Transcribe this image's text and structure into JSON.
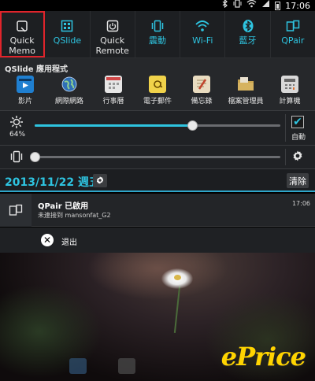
{
  "status_bar": {
    "time": "17:06",
    "icons": [
      "bluetooth-icon",
      "vibrate-icon",
      "wifi-icon",
      "signal-icon",
      "battery-icon"
    ]
  },
  "quick_toggles": [
    {
      "label_line1": "Quick",
      "label_line2": "Memo",
      "icon": "quick-memo-icon",
      "active": false
    },
    {
      "label_line1": "QSlide",
      "label_line2": "",
      "icon": "qslide-icon",
      "active": true
    },
    {
      "label_line1": "Quick",
      "label_line2": "Remote",
      "icon": "quick-remote-icon",
      "active": false
    },
    {
      "label_line1": "震動",
      "label_line2": "",
      "icon": "vibrate-icon",
      "active": true
    },
    {
      "label_line1": "Wi-Fi",
      "label_line2": "",
      "icon": "wifi-icon",
      "active": true
    },
    {
      "label_line1": "藍牙",
      "label_line2": "",
      "icon": "bluetooth-icon",
      "active": true
    },
    {
      "label_line1": "QPair",
      "label_line2": "",
      "icon": "qpair-icon",
      "active": true
    }
  ],
  "qslide": {
    "title": "QSlide 應用程式",
    "apps": [
      {
        "label": "影片",
        "icon": "video-icon",
        "color": "#1f7fd0"
      },
      {
        "label": "網際網路",
        "icon": "globe-icon",
        "color": "#2f6fb6"
      },
      {
        "label": "行事曆",
        "icon": "calendar-icon",
        "color": "#e6e6e6"
      },
      {
        "label": "電子郵件",
        "icon": "email-icon",
        "color": "#e8c233"
      },
      {
        "label": "備忘錄",
        "icon": "memo-icon",
        "color": "#c9a05a"
      },
      {
        "label": "檔案管理員",
        "icon": "folder-icon",
        "color": "#c9a550"
      },
      {
        "label": "計算機",
        "icon": "calculator-icon",
        "color": "#cfcfcf"
      }
    ]
  },
  "brightness": {
    "percent_label": "64%",
    "level": 0.64,
    "auto_label": "自動",
    "auto_checked": true
  },
  "volume": {
    "level": 0.0
  },
  "date_bar": {
    "date": "2013/11/22 週五",
    "clear_label": "清除"
  },
  "notification": {
    "title": "QPair 已啟用",
    "subtitle": "未連接到 mansonfat_G2",
    "time": "17:06",
    "action_label": "退出"
  },
  "watermark": "ePrice",
  "colors": {
    "accent": "#2ec4e0",
    "selection_outline": "#e0242b",
    "watermark": "#ffd400"
  }
}
